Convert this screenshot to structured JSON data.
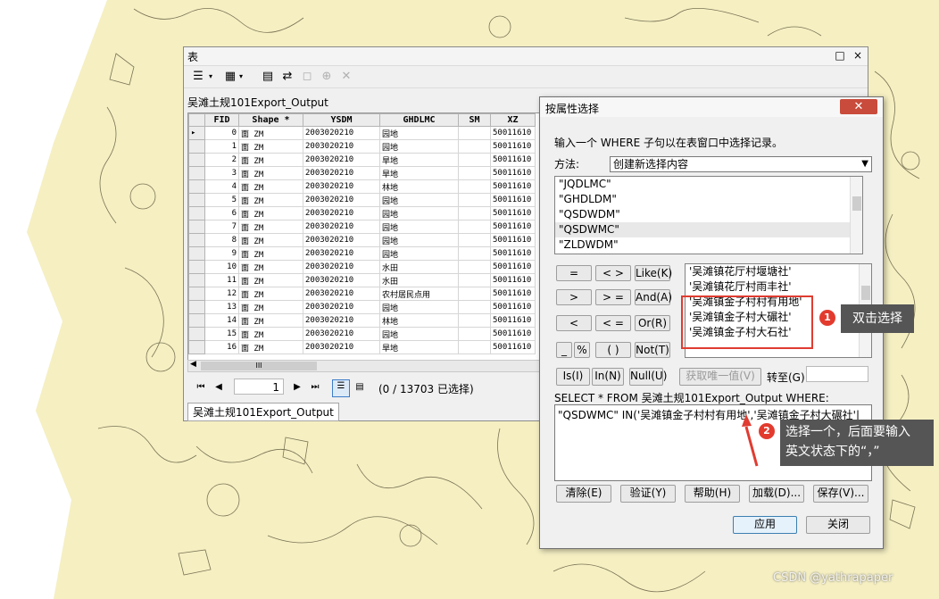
{
  "table_window": {
    "title": "表",
    "controls": [
      "□",
      "×"
    ],
    "table_name": "吴滩土规101Export_Output",
    "columns": [
      "FID",
      "Shape *",
      "YSDM",
      "GHDLMC",
      "SM",
      "XZ"
    ],
    "rows": [
      [
        "0",
        "面 ZM",
        "2003020210",
        "园地",
        "",
        "50011610"
      ],
      [
        "1",
        "面 ZM",
        "2003020210",
        "园地",
        "",
        "50011610"
      ],
      [
        "2",
        "面 ZM",
        "2003020210",
        "旱地",
        "",
        "50011610"
      ],
      [
        "3",
        "面 ZM",
        "2003020210",
        "旱地",
        "",
        "50011610"
      ],
      [
        "4",
        "面 ZM",
        "2003020210",
        "林地",
        "",
        "50011610"
      ],
      [
        "5",
        "面 ZM",
        "2003020210",
        "园地",
        "",
        "50011610"
      ],
      [
        "6",
        "面 ZM",
        "2003020210",
        "园地",
        "",
        "50011610"
      ],
      [
        "7",
        "面 ZM",
        "2003020210",
        "园地",
        "",
        "50011610"
      ],
      [
        "8",
        "面 ZM",
        "2003020210",
        "园地",
        "",
        "50011610"
      ],
      [
        "9",
        "面 ZM",
        "2003020210",
        "园地",
        "",
        "50011610"
      ],
      [
        "10",
        "面 ZM",
        "2003020210",
        "水田",
        "",
        "50011610"
      ],
      [
        "11",
        "面 ZM",
        "2003020210",
        "水田",
        "",
        "50011610"
      ],
      [
        "12",
        "面 ZM",
        "2003020210",
        "农村居民点用",
        "",
        "50011610"
      ],
      [
        "13",
        "面 ZM",
        "2003020210",
        "园地",
        "",
        "50011610"
      ],
      [
        "14",
        "面 ZM",
        "2003020210",
        "林地",
        "",
        "50011610"
      ],
      [
        "15",
        "面 ZM",
        "2003020210",
        "园地",
        "",
        "50011610"
      ],
      [
        "16",
        "面 ZM",
        "2003020210",
        "旱地",
        "",
        "50011610"
      ]
    ],
    "current_record": "1",
    "selection_status": "(0 / 13703 已选择)",
    "tab_label": "吴滩土规101Export_Output",
    "scroll_label": "III"
  },
  "dialog": {
    "title": "按属性选择",
    "close_label": "✕",
    "instruction": "输入一个 WHERE 子句以在表窗口中选择记录。",
    "method_label": "方法:",
    "method_value": "创建新选择内容",
    "fields": [
      "\"JQDLMC\"",
      "\"GHDLDM\"",
      "\"QSDWDM\"",
      "\"QSDWMC\"",
      "\"ZLDWDM\""
    ],
    "operators": [
      "=",
      "< >",
      "Like(K)",
      ">",
      "> =",
      "And(A)",
      "<",
      "< =",
      "Or(R)",
      "_",
      "%",
      "( )",
      "Not(T)"
    ],
    "values": [
      "'吴滩镇花厅村堰塘社'",
      "'吴滩镇花厅村雨丰社'",
      "'吴滩镇金子村村有用地'",
      "'吴滩镇金子村大碾社'",
      "'吴滩镇金子村大石社'"
    ],
    "is_btn": "Is(I)",
    "in_btn": "In(N)",
    "null_btn": "Null(U)",
    "unique_btn": "获取唯一值(V)",
    "goto_label": "转至(G):",
    "sql_prefix": "SELECT * FROM 吴滩土规101Export_Output WHERE:",
    "where_text": "\"QSDWMC\" IN('吴滩镇金子村村有用地','吴滩镇金子村大碾社'|",
    "actions": [
      "清除(E)",
      "验证(Y)",
      "帮助(H)",
      "加载(D)...",
      "保存(V)..."
    ],
    "apply": "应用",
    "close": "关闭"
  },
  "annotations": {
    "step1_badge": "1",
    "step1_text": "双击选择",
    "step2_badge": "2",
    "step2_text_line1": "选择一个，后面要输入",
    "step2_text_line2": "英文状态下的“，”"
  },
  "watermark": "CSDN @yathrapaper",
  "colors": {
    "map_bg": "#f5efc2",
    "annotation_red": "#e03c31",
    "callout_bg": "#555555"
  }
}
